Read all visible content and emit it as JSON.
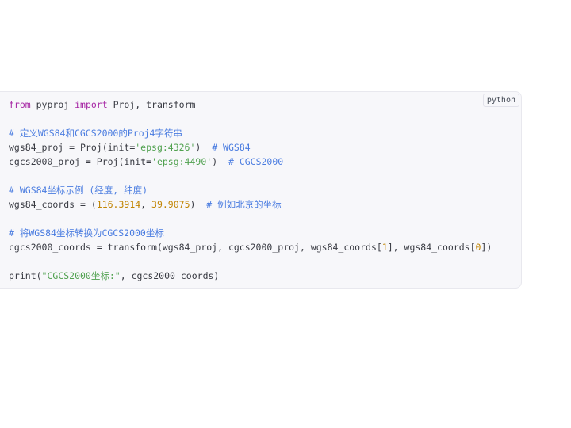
{
  "code_block": {
    "language": "python",
    "lines": [
      [
        {
          "t": "kw",
          "v": "from"
        },
        {
          "t": "tx",
          "v": " pyproj "
        },
        {
          "t": "kw",
          "v": "import"
        },
        {
          "t": "tx",
          "v": " Proj, transform"
        }
      ],
      [],
      [
        {
          "t": "cm",
          "v": "# 定义WGS84和CGCS2000的Proj4字符串"
        }
      ],
      [
        {
          "t": "tx",
          "v": "wgs84_proj = Proj(init="
        },
        {
          "t": "st",
          "v": "'epsg:4326'"
        },
        {
          "t": "tx",
          "v": ")  "
        },
        {
          "t": "cm",
          "v": "# WGS84"
        }
      ],
      [
        {
          "t": "tx",
          "v": "cgcs2000_proj = Proj(init="
        },
        {
          "t": "st",
          "v": "'epsg:4490'"
        },
        {
          "t": "tx",
          "v": ")  "
        },
        {
          "t": "cm",
          "v": "# CGCS2000"
        }
      ],
      [],
      [
        {
          "t": "cm",
          "v": "# WGS84坐标示例 (经度, 纬度)"
        }
      ],
      [
        {
          "t": "tx",
          "v": "wgs84_coords = ("
        },
        {
          "t": "nu",
          "v": "116.3914"
        },
        {
          "t": "tx",
          "v": ", "
        },
        {
          "t": "nu",
          "v": "39.9075"
        },
        {
          "t": "tx",
          "v": ")  "
        },
        {
          "t": "cm",
          "v": "# 例如北京的坐标"
        }
      ],
      [],
      [
        {
          "t": "cm",
          "v": "# 将WGS84坐标转换为CGCS2000坐标"
        }
      ],
      [
        {
          "t": "tx",
          "v": "cgcs2000_coords = transform(wgs84_proj, cgcs2000_proj, wgs84_coords["
        },
        {
          "t": "nu",
          "v": "1"
        },
        {
          "t": "tx",
          "v": "], wgs84_coords["
        },
        {
          "t": "nu",
          "v": "0"
        },
        {
          "t": "tx",
          "v": "])"
        }
      ],
      [],
      [
        {
          "t": "tx",
          "v": "print("
        },
        {
          "t": "st",
          "v": "\"CGCS2000坐标:\""
        },
        {
          "t": "tx",
          "v": ", cgcs2000_coords)"
        }
      ]
    ]
  },
  "colors": {
    "background": "#f7f7fa",
    "keyword": "#a626a4",
    "comment": "#4a7ce0",
    "string": "#50a14f",
    "number": "#c18401",
    "text": "#383a42"
  }
}
